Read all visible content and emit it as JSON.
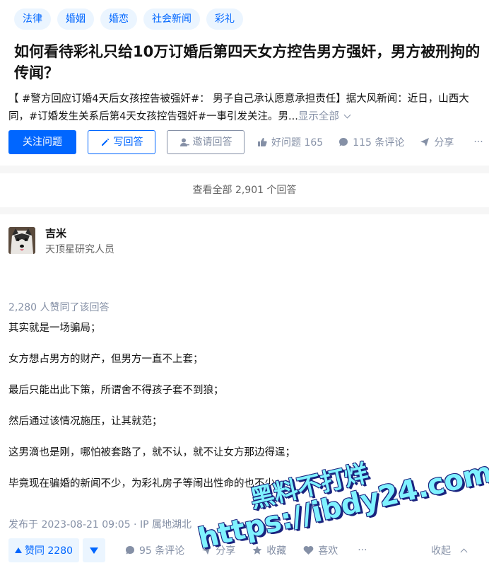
{
  "question": {
    "topics": [
      "法律",
      "婚姻",
      "婚恋",
      "社会新闻",
      "彩礼"
    ],
    "title": "如何看待彩礼只给10万订婚后第四天女方控告男方强奸，男方被刑拘的传闻？",
    "excerpt_line1": "【 #警方回应订婚4天后女孩控告被强奸#： 男子自己承认愿意承担责任】据大风新闻：近日，山西大",
    "excerpt_line2": "同，#订婚发生关系后第4天女孩控告强奸#一事引发关注。男...",
    "show_all": "显示全部",
    "follow_label": "关注问题",
    "write_label": "写回答",
    "invite_label": "邀请回答",
    "good_question": "好问题 165",
    "comments": "115 条评论",
    "share": "分享",
    "more": "···"
  },
  "view_all": "查看全部 2,901 个回答",
  "answer": {
    "author_name": "吉米",
    "author_headline": "天顶星研究人员",
    "votes_line": "2,280 人赞同了该回答",
    "paragraphs": [
      "其实就是一场骗局；",
      "女方想占男方的财产，但男方一直不上套；",
      "最后只能出此下策，所谓舍不得孩子套不到狼；",
      "然后通过该情况施压，让其就范；",
      "这男滴也是刚，哪怕被套路了，就不认，就不让女方那边得逞；",
      "毕竟现在骗婚的新闻不少，为彩礼房子等闹出性命的也不少；"
    ],
    "published": "发布于 2023-08-21 09:05 · IP 属地湖北",
    "upvote_label": "赞同 2280",
    "comments": "95 条评论",
    "share": "分享",
    "favorite": "收藏",
    "like": "喜欢",
    "more": "···",
    "collapse": "收起"
  },
  "watermark": {
    "line1": "黑料不打烊",
    "line2": "https://ibdy24.com"
  },
  "colors": {
    "brand_blue": "#0066ff",
    "topic_bg": "#ebf5ff",
    "muted_gray": "#8590a6",
    "page_bg": "#f6f6f6"
  }
}
